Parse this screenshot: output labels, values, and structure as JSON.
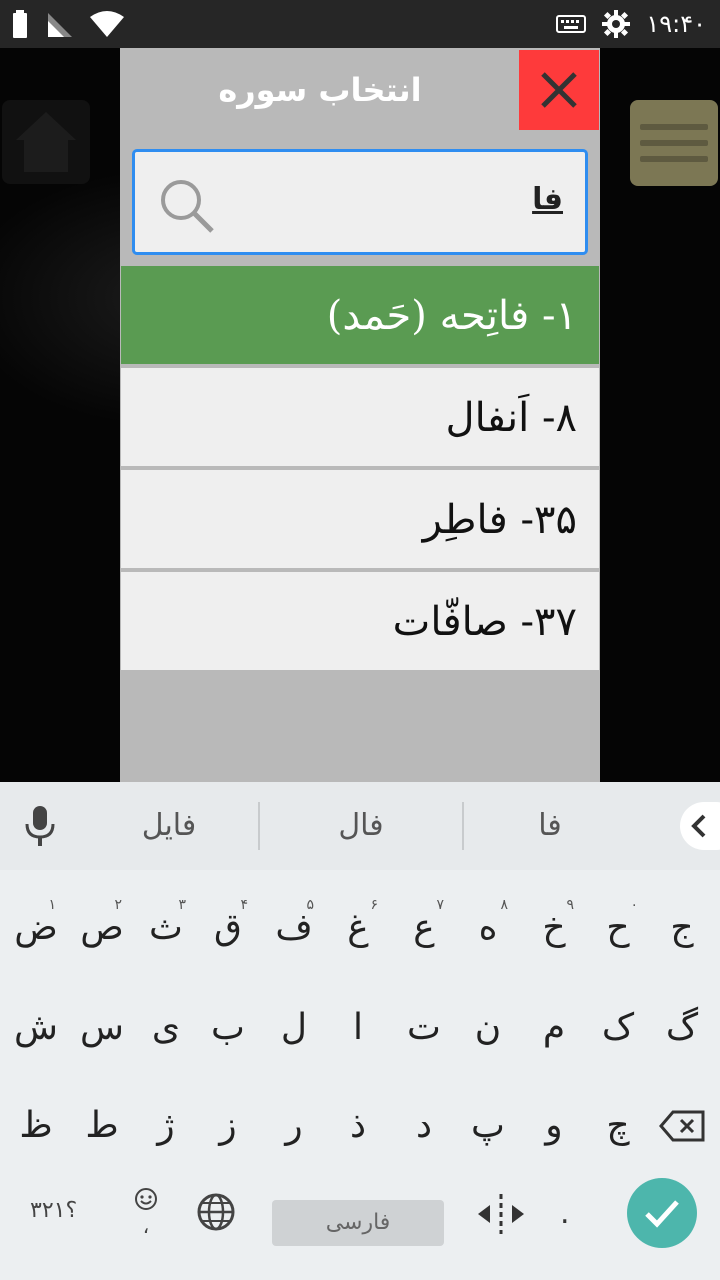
{
  "status_bar": {
    "time": "۱۹:۴۰",
    "icons": [
      "battery-icon",
      "signal-icon",
      "wifi-icon",
      "keyboard-icon",
      "settings-gear-icon"
    ]
  },
  "dialog": {
    "title": "انتخاب سوره",
    "search": {
      "value": "فا"
    },
    "results": [
      {
        "label": "۱- فاتِحه (حَمد)",
        "selected": true
      },
      {
        "label": "۸- اَنفال",
        "selected": false
      },
      {
        "label": "۳۵- فاطِر",
        "selected": false
      },
      {
        "label": "۳۷- صافّات",
        "selected": false
      }
    ]
  },
  "keyboard": {
    "suggestions": [
      "فا",
      "فال",
      "فایل"
    ],
    "row1": [
      {
        "char": "ج",
        "hint": ""
      },
      {
        "char": "ح",
        "hint": "۰"
      },
      {
        "char": "خ",
        "hint": "۹"
      },
      {
        "char": "ه",
        "hint": "۸"
      },
      {
        "char": "ع",
        "hint": "۷"
      },
      {
        "char": "غ",
        "hint": "۶"
      },
      {
        "char": "ف",
        "hint": "۵"
      },
      {
        "char": "ق",
        "hint": "۴"
      },
      {
        "char": "ث",
        "hint": "۳"
      },
      {
        "char": "ص",
        "hint": "۲"
      },
      {
        "char": "ض",
        "hint": "۱"
      }
    ],
    "row2": [
      "گ",
      "ک",
      "م",
      "ن",
      "ت",
      "ا",
      "ل",
      "ب",
      "ی",
      "س",
      "ش"
    ],
    "row3": [
      "چ",
      "و",
      "پ",
      "د",
      "ذ",
      "ر",
      "ز",
      "ژ",
      "ط",
      "ظ"
    ],
    "space_label": "فارسی",
    "symbols_label": "؟۳۲۱",
    "comma": "،",
    "period": "."
  },
  "colors": {
    "selected_row": "#5a9b52",
    "close_button": "#fe3a3b",
    "search_border": "#2f8df0",
    "enter_key": "#4db6ac"
  }
}
